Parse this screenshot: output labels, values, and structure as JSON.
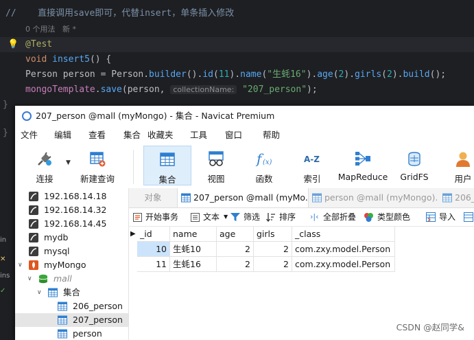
{
  "ide": {
    "comment": "//    直接调用save即可，代替insert，单条插入修改",
    "hint": "0 个用法   新 *",
    "annotation": "@Test",
    "line_method": [
      "void",
      "insert5",
      "() {"
    ],
    "line_builder": {
      "t1": "Person",
      "t2": "person",
      "t3": " = ",
      "t4": "Person",
      "t5": ".",
      "t6": "builder",
      "t7": "().",
      "t8": "id",
      "t9": "(",
      "t10": "11",
      "t11": ").",
      "t12": "name",
      "t13": "(",
      "t14": "\"生蚝16\"",
      "t15": ").",
      "t16": "age",
      "t17": "(",
      "t18": "2",
      "t19": ").",
      "t20": "girls",
      "t21": "(",
      "t22": "2",
      "t23": ").",
      "t24": "build",
      "t25": "();"
    },
    "line_save": {
      "t1": "mongoTemplate",
      "t2": ".",
      "t3": "save",
      "t4": "(person, ",
      "param": "collectionName:",
      "t5": "\"207_person\"",
      "t6": ");"
    },
    "gutter_marks": [
      "}",
      "}"
    ],
    "side_tabs": [
      "in",
      "✕",
      "ins",
      "✓"
    ]
  },
  "navicat": {
    "title": "207_person @mall (myMongo) - 集合 - Navicat Premium",
    "menu": [
      "文件",
      "编辑",
      "查看",
      "集合",
      "收藏夹",
      "工具",
      "窗口",
      "帮助"
    ],
    "toolbar": [
      {
        "label": "连接",
        "icon": "plug-icon"
      },
      {
        "label": "新建查询",
        "icon": "new-query-icon"
      },
      {
        "label": "集合",
        "icon": "collection-icon",
        "active": true
      },
      {
        "label": "视图",
        "icon": "view-icon"
      },
      {
        "label": "函数",
        "icon": "function-icon"
      },
      {
        "label": "索引",
        "icon": "az-index-icon"
      },
      {
        "label": "MapReduce",
        "icon": "mapreduce-icon"
      },
      {
        "label": "GridFS",
        "icon": "gridfs-icon"
      },
      {
        "label": "用户",
        "icon": "user-icon"
      }
    ],
    "tree": [
      {
        "label": "192.168.14.18",
        "kind": "server",
        "level": 0
      },
      {
        "label": "192.168.14.32",
        "kind": "server",
        "level": 0
      },
      {
        "label": "192.168.14.45",
        "kind": "server",
        "level": 0
      },
      {
        "label": "mydb",
        "kind": "server",
        "level": 0
      },
      {
        "label": "mysql",
        "kind": "server",
        "level": 0
      },
      {
        "label": "myMongo",
        "kind": "mongo",
        "level": 0,
        "expanded": true
      },
      {
        "label": "mall",
        "kind": "db",
        "level": 1,
        "expanded": true
      },
      {
        "label": "集合",
        "kind": "folder",
        "level": 2,
        "expanded": true
      },
      {
        "label": "206_person",
        "kind": "table",
        "level": 3
      },
      {
        "label": "207_person",
        "kind": "table",
        "level": 3,
        "selected": true
      },
      {
        "label": "person",
        "kind": "table",
        "level": 3
      }
    ],
    "tabs": [
      {
        "label": "对象",
        "active": false
      },
      {
        "label": "207_person @mall (myMo...",
        "active": true
      },
      {
        "label": "person @mall (myMongo)...",
        "active": false
      },
      {
        "label": "206_",
        "active": false
      }
    ],
    "subbar": [
      "开始事务",
      "文本",
      "筛选",
      "排序",
      "全部折叠",
      "类型颜色",
      "导入",
      ""
    ],
    "grid": {
      "headers": [
        "_id",
        "name",
        "age",
        "girls",
        "_class"
      ],
      "rows": [
        [
          "10",
          "生蚝10",
          "2",
          "2",
          "com.zxy.model.Person"
        ],
        [
          "11",
          "生蚝16",
          "2",
          "2",
          "com.zxy.model.Person"
        ]
      ]
    }
  },
  "watermark": "CSDN @赵同学&"
}
